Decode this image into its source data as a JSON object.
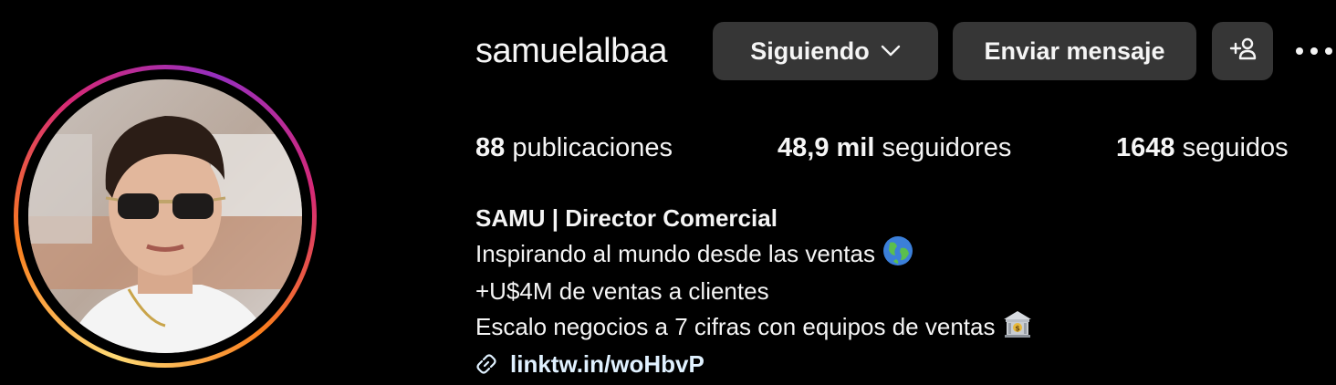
{
  "profile": {
    "username": "samuelalbaa",
    "avatar_alt": "profile photo"
  },
  "actions": {
    "follow_label": "Siguiendo",
    "message_label": "Enviar mensaje",
    "add_user_icon": "add-user-icon",
    "more_icon": "more-options-icon"
  },
  "stats": {
    "posts_count": "88",
    "posts_label": "publicaciones",
    "followers_count": "48,9 mil",
    "followers_label": "seguidores",
    "following_count": "1648",
    "following_label": "seguidos"
  },
  "bio": {
    "name": "SAMU | Director Comercial",
    "lines": [
      "Inspirando al mundo desde las ventas",
      "+U$4M de ventas a clientes",
      "Escalo negocios a 7 cifras con equipos de ventas"
    ],
    "link": "linktw.in/woHbvP"
  },
  "colors": {
    "background": "#000000",
    "button": "#363636",
    "text": "#f5f5f5",
    "link": "#e0f1ff"
  }
}
